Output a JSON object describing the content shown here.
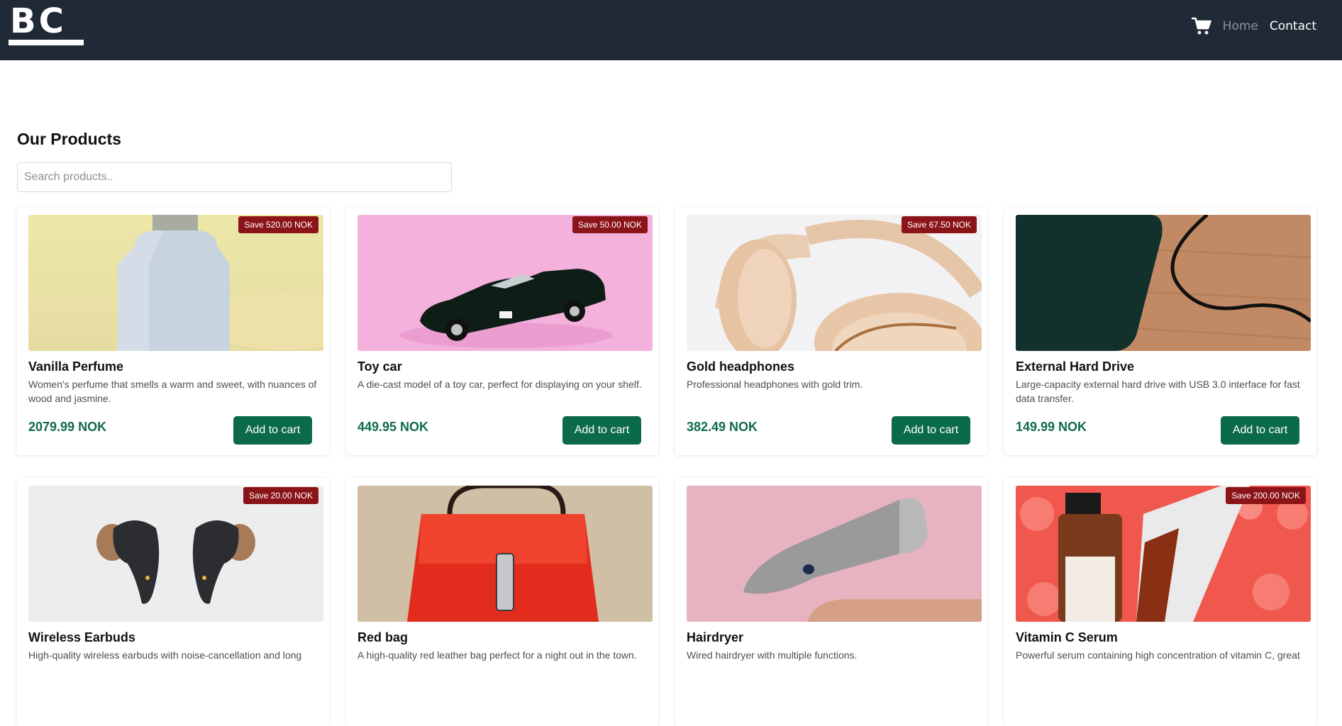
{
  "header": {
    "logo_text": "BC",
    "nav": {
      "home": "Home",
      "contact": "Contact"
    }
  },
  "main": {
    "title": "Our Products",
    "search_placeholder": "Search products..",
    "add_label": "Add to cart",
    "products": [
      {
        "name": "Vanilla Perfume",
        "desc": "Women's perfume that smells a warm and sweet, with nuances of wood and jasmine.",
        "price": "2079.99 NOK",
        "badge": "Save 520.00 NOK"
      },
      {
        "name": "Toy car",
        "desc": "A die-cast model of a toy car, perfect for displaying on your shelf.",
        "price": "449.95 NOK",
        "badge": "Save 50.00 NOK"
      },
      {
        "name": "Gold headphones",
        "desc": "Professional headphones with gold trim.",
        "price": "382.49 NOK",
        "badge": "Save 67.50 NOK"
      },
      {
        "name": "External Hard Drive",
        "desc": "Large-capacity external hard drive with USB 3.0 interface for fast data transfer.",
        "price": "149.99 NOK",
        "badge": ""
      },
      {
        "name": "Wireless Earbuds",
        "desc": "High-quality wireless earbuds with noise-cancellation and long",
        "price": "",
        "badge": "Save 20.00 NOK"
      },
      {
        "name": "Red bag",
        "desc": "A high-quality red leather bag perfect for a night out in the town.",
        "price": "",
        "badge": ""
      },
      {
        "name": "Hairdryer",
        "desc": "Wired hairdryer with multiple functions.",
        "price": "",
        "badge": ""
      },
      {
        "name": "Vitamin C Serum",
        "desc": "Powerful serum containing high concentration of vitamin C, great",
        "price": "",
        "badge": "Save 200.00 NOK"
      }
    ]
  }
}
